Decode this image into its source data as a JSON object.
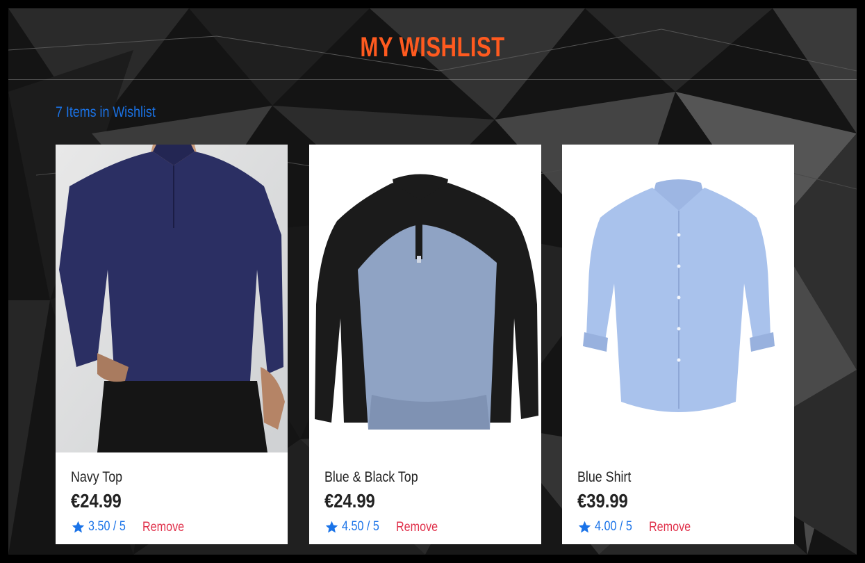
{
  "page": {
    "title": "MY WISHLIST",
    "item_count": "7 Items in Wishlist"
  },
  "colors": {
    "title": "#ff5a1f",
    "accent_blue": "#1a73e8",
    "remove_red": "#e0304a",
    "card_bg": "#ffffff"
  },
  "products": [
    {
      "name": "Navy Top",
      "price": "€24.99",
      "rating": "3.50 / 5",
      "remove_label": "Remove",
      "image": "navy-quarter-zip-top-on-model",
      "color": "#2b2f63"
    },
    {
      "name": "Blue & Black Top",
      "price": "€24.99",
      "rating": "4.50 / 5",
      "remove_label": "Remove",
      "image": "blue-black-quarter-zip-top",
      "color": "#8fa3c4"
    },
    {
      "name": "Blue Shirt",
      "price": "€39.99",
      "rating": "4.00 / 5",
      "remove_label": "Remove",
      "image": "light-blue-button-down-shirt",
      "color": "#a9c2ec"
    }
  ],
  "icons": {
    "rating": "star-icon"
  }
}
